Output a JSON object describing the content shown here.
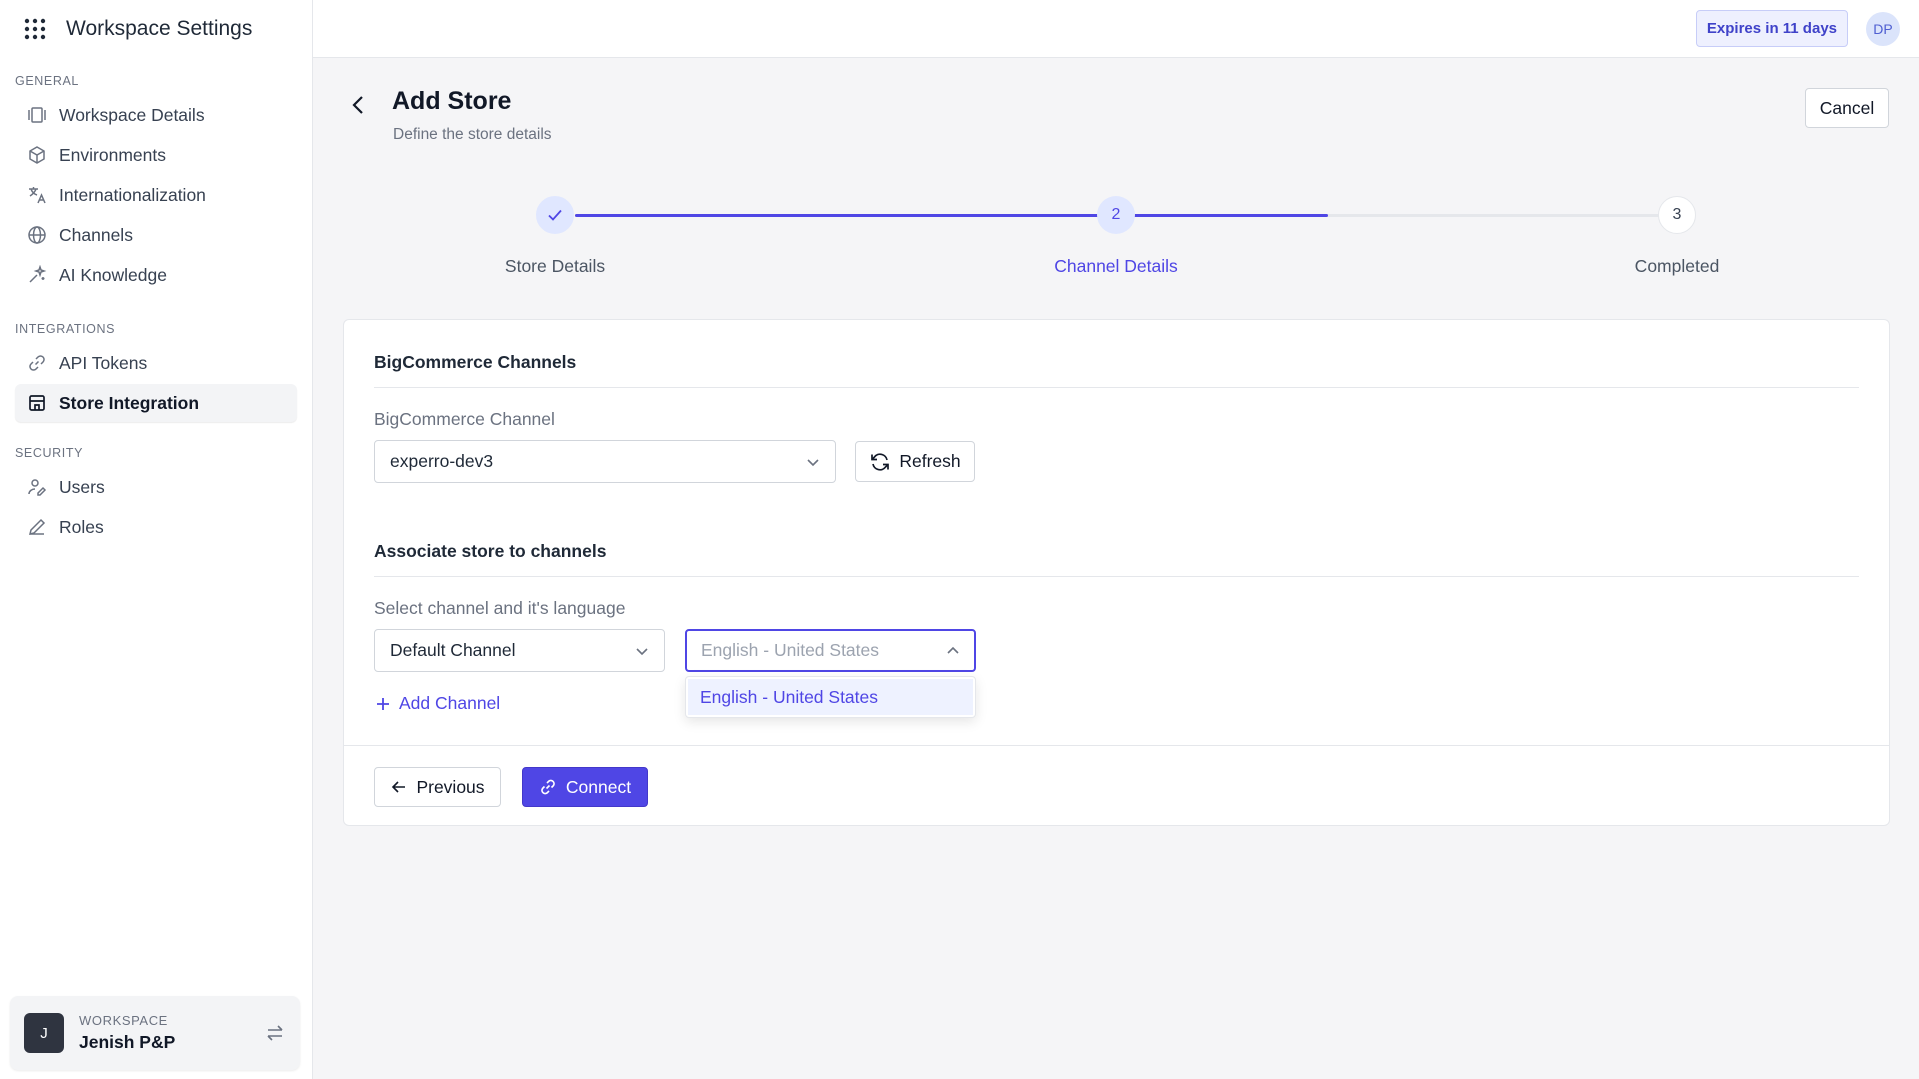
{
  "sidebar": {
    "title": "Workspace Settings",
    "sections": [
      {
        "label": "GENERAL",
        "items": [
          {
            "label": "Workspace Details",
            "icon": "workspace-icon"
          },
          {
            "label": "Environments",
            "icon": "cube-icon"
          },
          {
            "label": "Internationalization",
            "icon": "translate-icon"
          },
          {
            "label": "Channels",
            "icon": "globe-icon"
          },
          {
            "label": "AI Knowledge",
            "icon": "sparkle-icon"
          }
        ]
      },
      {
        "label": "INTEGRATIONS",
        "items": [
          {
            "label": "API Tokens",
            "icon": "link-icon"
          },
          {
            "label": "Store Integration",
            "icon": "store-icon",
            "active": true
          }
        ]
      },
      {
        "label": "SECURITY",
        "items": [
          {
            "label": "Users",
            "icon": "users-icon"
          },
          {
            "label": "Roles",
            "icon": "pencil-icon"
          }
        ]
      }
    ],
    "workspace": {
      "label": "WORKSPACE",
      "name": "Jenish P&P",
      "avatar": "J"
    }
  },
  "topbar": {
    "expires": "Expires in 11 days",
    "user_initials": "DP"
  },
  "page": {
    "title": "Add Store",
    "subtitle": "Define the store details",
    "cancel": "Cancel"
  },
  "stepper": {
    "steps": [
      {
        "number": "",
        "label": "Store Details",
        "state": "done"
      },
      {
        "number": "2",
        "label": "Channel Details",
        "state": "current"
      },
      {
        "number": "3",
        "label": "Completed",
        "state": "upcoming"
      }
    ],
    "progress": 0.68
  },
  "form": {
    "section1_title": "BigCommerce Channels",
    "channel_label": "BigCommerce Channel",
    "channel_value": "experro-dev3",
    "refresh": "Refresh",
    "section2_title": "Associate store to channels",
    "assoc_label": "Select channel and it's language",
    "channel_select_value": "Default Channel",
    "language_placeholder": "English - United States",
    "language_options": [
      "English - United States"
    ],
    "add_channel": "Add Channel",
    "previous": "Previous",
    "connect": "Connect"
  },
  "colors": {
    "accent": "#4f46e5",
    "accent_light": "#eef2ff",
    "border": "#e5e7eb"
  }
}
